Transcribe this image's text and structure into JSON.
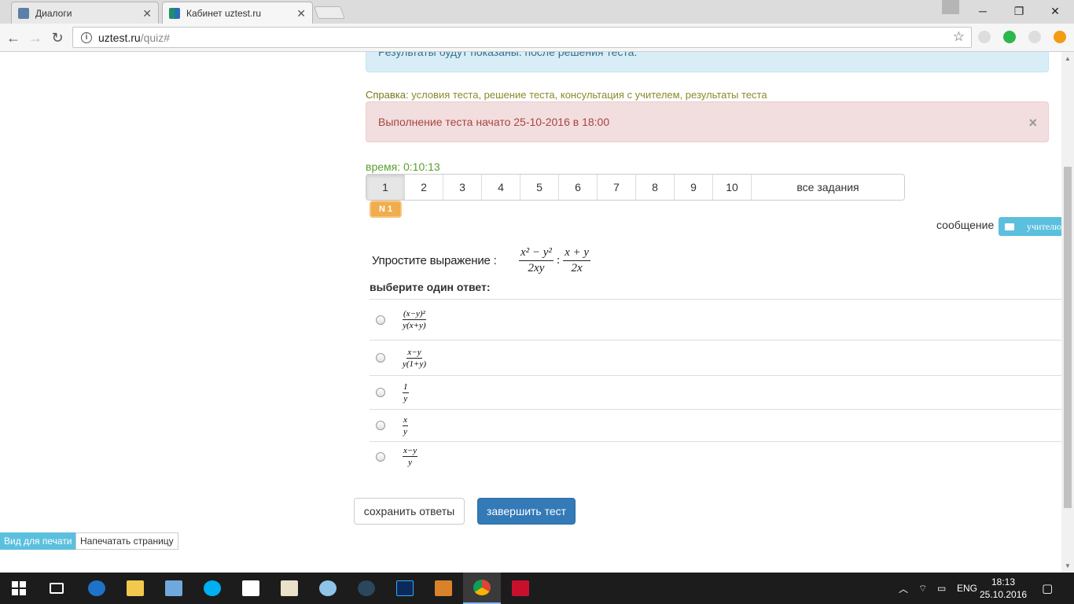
{
  "browser": {
    "tabs": [
      {
        "title": "Диалоги",
        "active": false
      },
      {
        "title": "Кабинет uztest.ru",
        "active": true
      }
    ],
    "url_host": "uztest.ru",
    "url_path": "/quiz#"
  },
  "page": {
    "info_alert": "Результаты будут показаны: после решения теста.",
    "help_label": "Справка:",
    "help_links": "условия теста, решение теста, консультация с учителем, результаты теста",
    "start_alert": "Выполнение теста начато 25-10-2016 в 18:00",
    "close_glyph": "×",
    "timer": "время: 0:10:13",
    "pages": [
      "1",
      "2",
      "3",
      "4",
      "5",
      "6",
      "7",
      "8",
      "9",
      "10"
    ],
    "active_page": "1",
    "all_tasks": "все задания",
    "question_badge": "N 1",
    "message_label": "сообщение",
    "teacher_button": "учителю",
    "question_text": "Упростите выражение :",
    "expression": {
      "left_num": "x² − y²",
      "left_den": "2xy",
      "op": ":",
      "right_num": "x + y",
      "right_den": "2x"
    },
    "choose_label": "выберите один ответ:",
    "answers": [
      {
        "num": "(x−y)²",
        "den": "y(x+y)"
      },
      {
        "num": "x−y",
        "den": "y(1+y)"
      },
      {
        "num": "1",
        "den": "y"
      },
      {
        "num": "x",
        "den": "y"
      },
      {
        "num": "x−y",
        "den": "y"
      }
    ],
    "save_button": "сохранить ответы",
    "finish_button": "завершить тест",
    "print_view_button": "Вид для печати",
    "print_page_button": "Напечатать страницу"
  },
  "taskbar": {
    "language": "ENG",
    "time": "18:13",
    "date": "25.10.2016"
  }
}
